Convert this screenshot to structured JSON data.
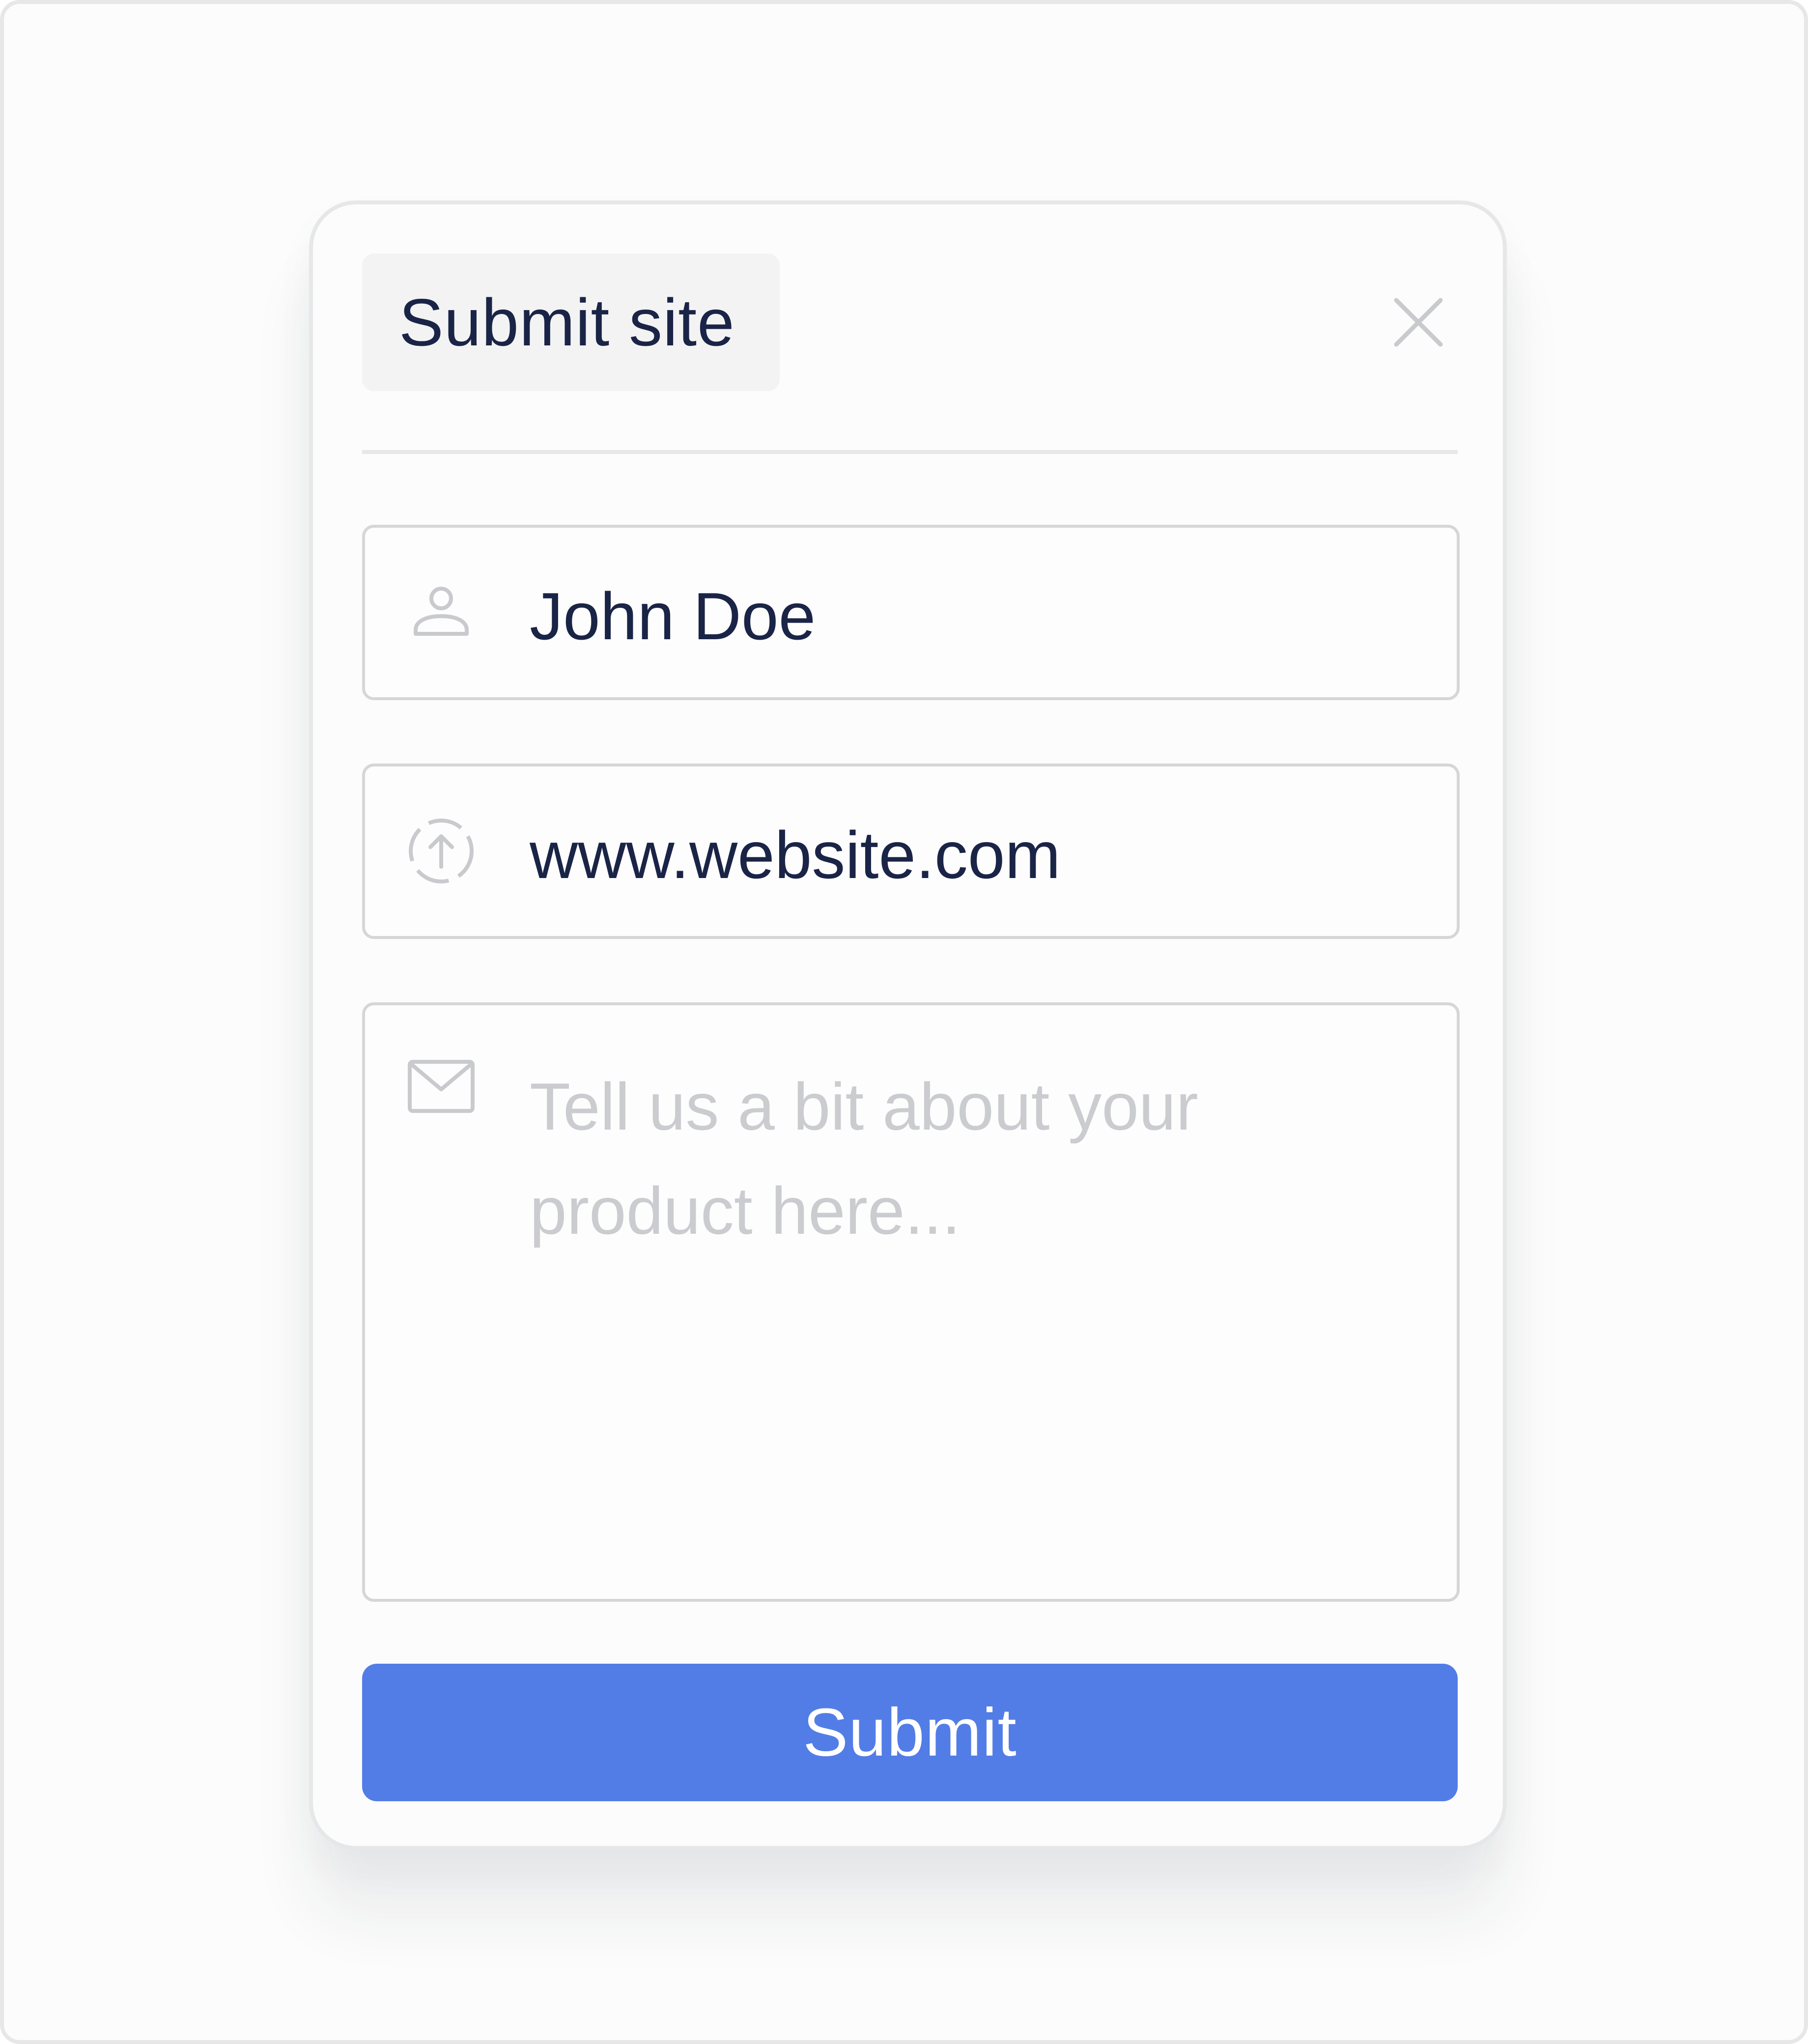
{
  "dialog": {
    "title": "Submit site",
    "close_icon": "close-icon"
  },
  "fields": {
    "name": {
      "icon": "user-icon",
      "value": "John Doe"
    },
    "website": {
      "icon": "upload-circle-icon",
      "value": "www.website.com"
    },
    "description": {
      "icon": "mail-icon",
      "value": "",
      "placeholder": "Tell us a bit about your product here..."
    }
  },
  "submit": {
    "label": "Submit"
  },
  "colors": {
    "accent": "#537de6",
    "text": "#1a2446",
    "placeholder": "#cbccd0",
    "icon": "#c9cacd",
    "border": "#d6d6d8"
  }
}
